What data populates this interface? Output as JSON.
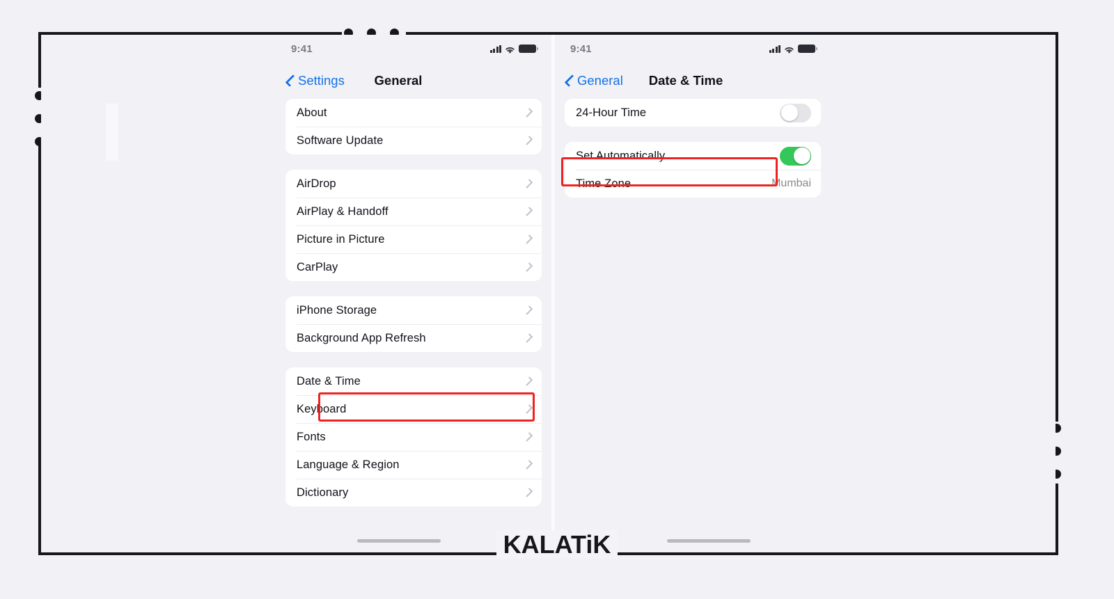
{
  "brand": {
    "watermark": "KALATiK"
  },
  "left_phone": {
    "status_bar": {
      "time": "9:41",
      "icons": [
        "cellular-signal-icon",
        "wifi-icon",
        "battery-icon"
      ]
    },
    "nav": {
      "back_label": "Settings",
      "back_icon": "chevron-left-icon",
      "title": "General"
    },
    "groups": [
      {
        "rows": [
          {
            "label": "About",
            "accessory": "chevron-right-icon"
          },
          {
            "label": "Software Update",
            "accessory": "chevron-right-icon"
          }
        ]
      },
      {
        "rows": [
          {
            "label": "AirDrop",
            "accessory": "chevron-right-icon"
          },
          {
            "label": "AirPlay & Handoff",
            "accessory": "chevron-right-icon"
          },
          {
            "label": "Picture in Picture",
            "accessory": "chevron-right-icon"
          },
          {
            "label": "CarPlay",
            "accessory": "chevron-right-icon"
          }
        ]
      },
      {
        "rows": [
          {
            "label": "iPhone Storage",
            "accessory": "chevron-right-icon"
          },
          {
            "label": "Background App Refresh",
            "accessory": "chevron-right-icon"
          }
        ]
      },
      {
        "rows": [
          {
            "label": "Date & Time",
            "accessory": "chevron-right-icon",
            "highlighted": true
          },
          {
            "label": "Keyboard",
            "accessory": "chevron-right-icon"
          },
          {
            "label": "Fonts",
            "accessory": "chevron-right-icon"
          },
          {
            "label": "Language & Region",
            "accessory": "chevron-right-icon"
          },
          {
            "label": "Dictionary",
            "accessory": "chevron-right-icon"
          }
        ]
      }
    ]
  },
  "right_phone": {
    "status_bar": {
      "time": "9:41",
      "icons": [
        "cellular-signal-icon",
        "wifi-icon",
        "battery-icon"
      ]
    },
    "nav": {
      "back_label": "General",
      "back_icon": "chevron-left-icon",
      "title": "Date & Time"
    },
    "groups": [
      {
        "rows": [
          {
            "label": "24-Hour Time",
            "accessory": "toggle",
            "toggle_on": false
          }
        ]
      },
      {
        "rows": [
          {
            "label": "Set Automatically",
            "accessory": "toggle",
            "toggle_on": true,
            "highlighted": true
          },
          {
            "label": "Time Zone",
            "accessory": "value",
            "value": "Mumbai"
          }
        ]
      }
    ]
  },
  "colors": {
    "accent_blue": "#1272e8",
    "toggle_on_green": "#34c759",
    "toggle_off_gray": "#e4e4e9",
    "highlight_red": "#ee2222",
    "page_background": "#f1f1f6",
    "card_background": "#ffffff",
    "frame_black": "#16161d"
  }
}
